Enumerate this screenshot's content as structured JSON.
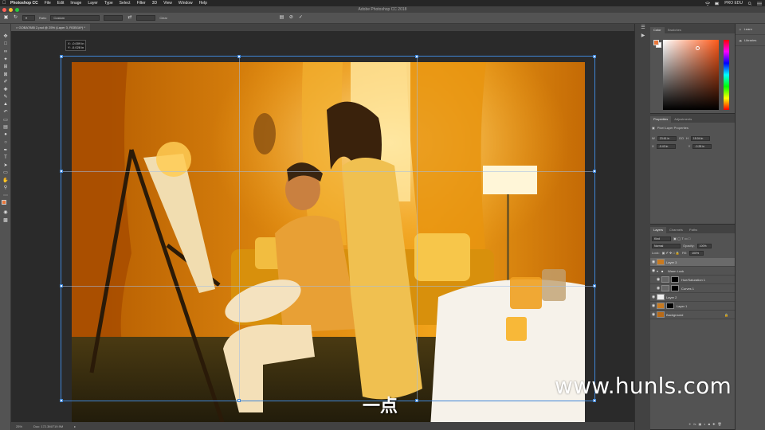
{
  "menubar": {
    "items": [
      "Photoshop CC",
      "File",
      "Edit",
      "Image",
      "Layer",
      "Type",
      "Select",
      "Filter",
      "3D",
      "View",
      "Window",
      "Help"
    ],
    "right_label": "PRO EDU"
  },
  "titlebar": {
    "title": "Adobe Photoshop CC 2018"
  },
  "options_bar": {
    "mode_label": "Ratio",
    "mode_value": "Custom",
    "clear_label": "Clear"
  },
  "document": {
    "tab_label": "GOBA7885 2.psd @ 25% (Layer 3, RGB/16*) *",
    "coord_tip_x": "X: -0.009 in",
    "coord_tip_y": "Y: -0.028 in"
  },
  "statusbar": {
    "zoom": "25%",
    "doc_info": "Doc: 172.3M/719.9M"
  },
  "color_panel": {
    "tabs": [
      "Color",
      "Swatches"
    ],
    "fg_color": "#e8763a",
    "bg_color": "#ffffff"
  },
  "properties_panel": {
    "tabs": [
      "Properties",
      "Adjustments"
    ],
    "subtitle": "Pixel Layer Properties",
    "w_label": "W",
    "w_value": "23.61 in",
    "go_label": "GO",
    "h_label": "H",
    "h_value": "15.04 in",
    "x_label": "X",
    "x_value": "-0.43 in",
    "y_label": "Y",
    "y_value": "-0.28 in"
  },
  "layers_panel": {
    "tabs": [
      "Layers",
      "Channels",
      "Paths"
    ],
    "kind_label": "Kind",
    "blend_mode": "Normal",
    "opacity_label": "Opacity:",
    "opacity": "100%",
    "fill_label": "Fill:",
    "fill": "100%",
    "lock_label": "Lock:",
    "layers": [
      {
        "name": "Layer 3",
        "selected": true,
        "thumb": "photo"
      },
      {
        "name": "Warm Look",
        "selected": false,
        "thumb": "folder"
      },
      {
        "name": "Hue/Saturation 1",
        "selected": false,
        "thumb": "adjust"
      },
      {
        "name": "Curves 1",
        "selected": false,
        "thumb": "adjust"
      },
      {
        "name": "Layer 2",
        "selected": false,
        "thumb": "white"
      },
      {
        "name": "Layer 1",
        "selected": false,
        "thumb": "photo"
      },
      {
        "name": "Background",
        "selected": false,
        "thumb": "photo"
      }
    ]
  },
  "libraries": {
    "items": [
      {
        "label": "Learn",
        "icon": "lightbulb-icon"
      },
      {
        "label": "Libraries",
        "icon": "cloud-icon"
      }
    ]
  },
  "overlay": {
    "watermark": "www.hunls.com",
    "subtitle": "一点"
  },
  "colors": {
    "ui_dark": "#424242",
    "ui_mid": "#535353",
    "canvas_bg": "#2a2a2a",
    "transform_blue": "#3f86d8"
  }
}
